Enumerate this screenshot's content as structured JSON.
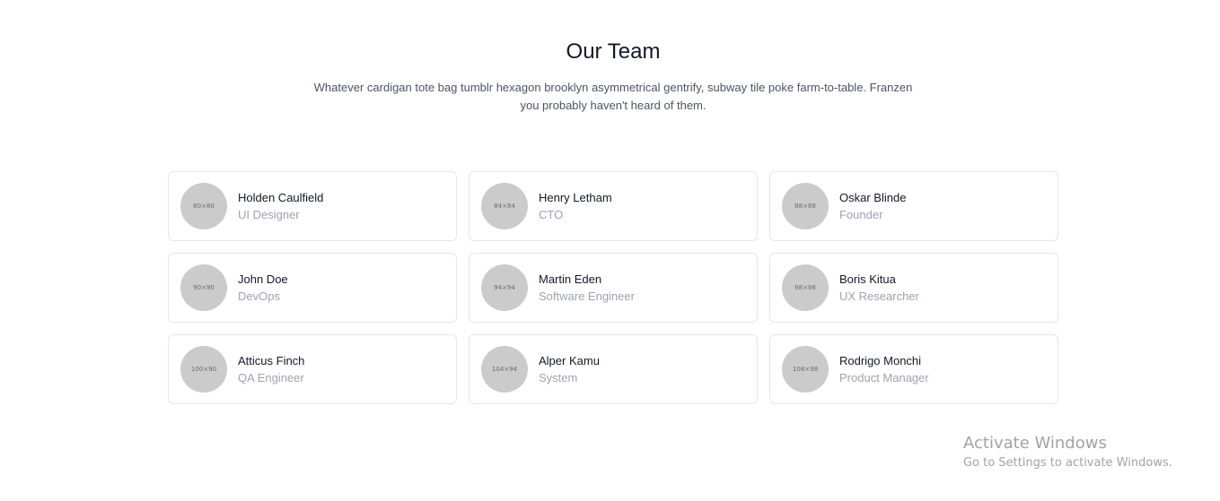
{
  "header": {
    "title": "Our Team",
    "description": "Whatever cardigan tote bag tumblr hexagon brooklyn asymmetrical gentrify, subway tile poke farm-to-table. Franzen you probably haven't heard of them."
  },
  "team": [
    {
      "avatar_label": "80×80",
      "name": "Holden Caulfield",
      "role": "UI Designer"
    },
    {
      "avatar_label": "84×84",
      "name": "Henry Letham",
      "role": "CTO"
    },
    {
      "avatar_label": "88×88",
      "name": "Oskar Blinde",
      "role": "Founder"
    },
    {
      "avatar_label": "90×90",
      "name": "John Doe",
      "role": "DevOps"
    },
    {
      "avatar_label": "94×94",
      "name": "Martin Eden",
      "role": "Software Engineer"
    },
    {
      "avatar_label": "98×98",
      "name": "Boris Kitua",
      "role": "UX Researcher"
    },
    {
      "avatar_label": "100×90",
      "name": "Atticus Finch",
      "role": "QA Engineer"
    },
    {
      "avatar_label": "104×94",
      "name": "Alper Kamu",
      "role": "System"
    },
    {
      "avatar_label": "108×98",
      "name": "Rodrigo Monchi",
      "role": "Product Manager"
    }
  ],
  "watermark": {
    "title": "Activate Windows",
    "subtitle": "Go to Settings to activate Windows."
  },
  "colors": {
    "avatar_bg": "#cbcbcb",
    "card_border": "#e5e7eb",
    "role_text": "#9ca3af"
  }
}
